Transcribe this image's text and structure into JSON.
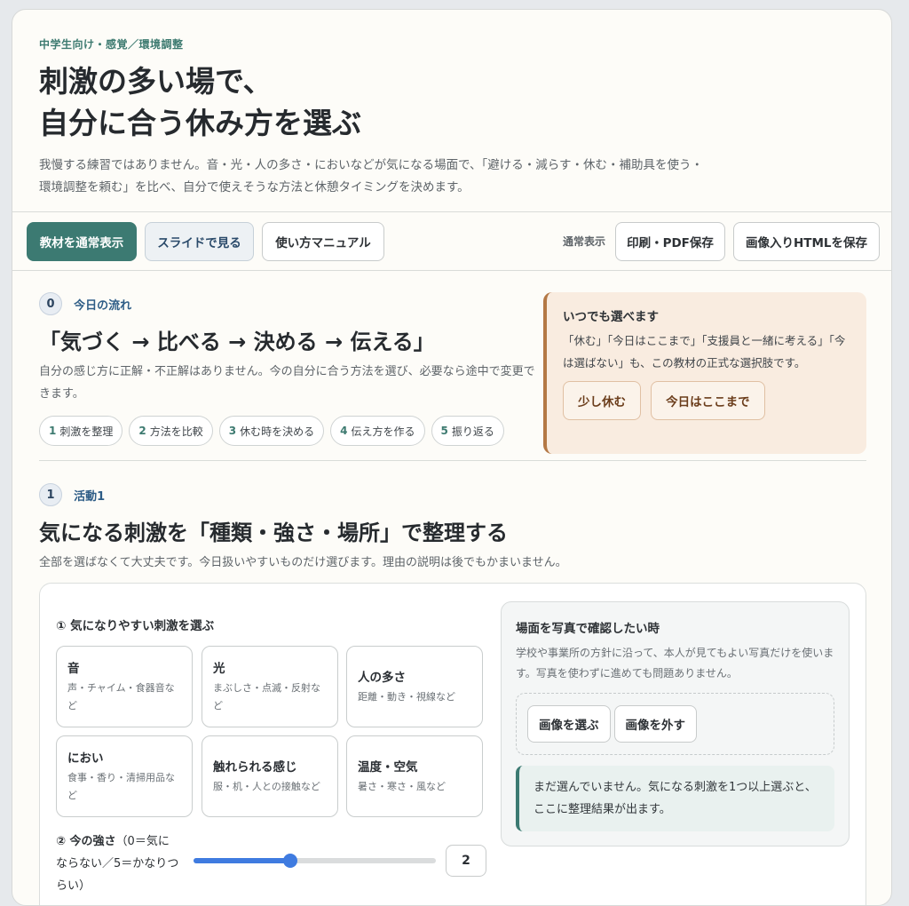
{
  "header": {
    "eyebrow": "中学生向け・感覚／環境調整",
    "title_line1": "刺激の多い場で、",
    "title_line2": "自分に合う休み方を選ぶ",
    "subtitle": "我慢する練習ではありません。音・光・人の多さ・においなどが気になる場面で、「避ける・減らす・休む・補助具を使う・環境調整を頼む」を比べ、自分で使えそうな方法と休憩タイミングを決めます。"
  },
  "toolbar": {
    "normal_view": "教材を通常表示",
    "slide_view": "スライドで見る",
    "manual": "使い方マニュアル",
    "mode_label": "通常表示",
    "print": "印刷・PDF保存",
    "save_html": "画像入りHTMLを保存"
  },
  "flow": {
    "num": "0",
    "label": "今日の流れ",
    "heading": "「気づく → 比べる → 決める → 伝える」",
    "desc": "自分の感じ方に正解・不正解はありません。今の自分に合う方法を選び、必要なら途中で変更できます。",
    "steps": [
      {
        "n": "1",
        "label": "刺激を整理"
      },
      {
        "n": "2",
        "label": "方法を比較"
      },
      {
        "n": "3",
        "label": "休む時を決める"
      },
      {
        "n": "4",
        "label": "伝え方を作る"
      },
      {
        "n": "5",
        "label": "振り返る"
      }
    ]
  },
  "anytime": {
    "title": "いつでも選べます",
    "text": "「休む」「今日はここまで」「支援員と一緒に考える」「今は選ばない」も、この教材の正式な選択肢です。",
    "rest_button": "少し休む",
    "stop_button": "今日はここまで"
  },
  "activity": {
    "num": "1",
    "label": "活動1",
    "heading": "気になる刺激を「種類・強さ・場所」で整理する",
    "desc": "全部を選ばなくて大丈夫です。今日扱いやすいものだけ選びます。理由の説明は後でもかまいません。",
    "choose_label": "① 気になりやすい刺激を選ぶ",
    "stimuli": [
      {
        "name": "音",
        "examples": "声・チャイム・食器音など"
      },
      {
        "name": "光",
        "examples": "まぶしさ・点滅・反射など"
      },
      {
        "name": "人の多さ",
        "examples": "距離・動き・視線など"
      },
      {
        "name": "におい",
        "examples": "食事・香り・清掃用品など"
      },
      {
        "name": "触れられる感じ",
        "examples": "服・机・人との接触など"
      },
      {
        "name": "温度・空気",
        "examples": "暑さ・寒さ・風など"
      }
    ],
    "strength_title": "② 今の強さ",
    "strength_hint": "（0＝気にならない／5＝かなりつらい）",
    "strength_value": "2",
    "strength_fraction": 0.4,
    "photo": {
      "title": "場面を写真で確認したい時",
      "text": "学校や事業所の方針に沿って、本人が見てもよい写真だけを使います。写真を使わずに進めても問題ありません。",
      "choose_image": "画像を選ぶ",
      "remove_image": "画像を外す",
      "notice": "まだ選んでいません。気になる刺激を1つ以上選ぶと、ここに整理結果が出ます。"
    }
  }
}
